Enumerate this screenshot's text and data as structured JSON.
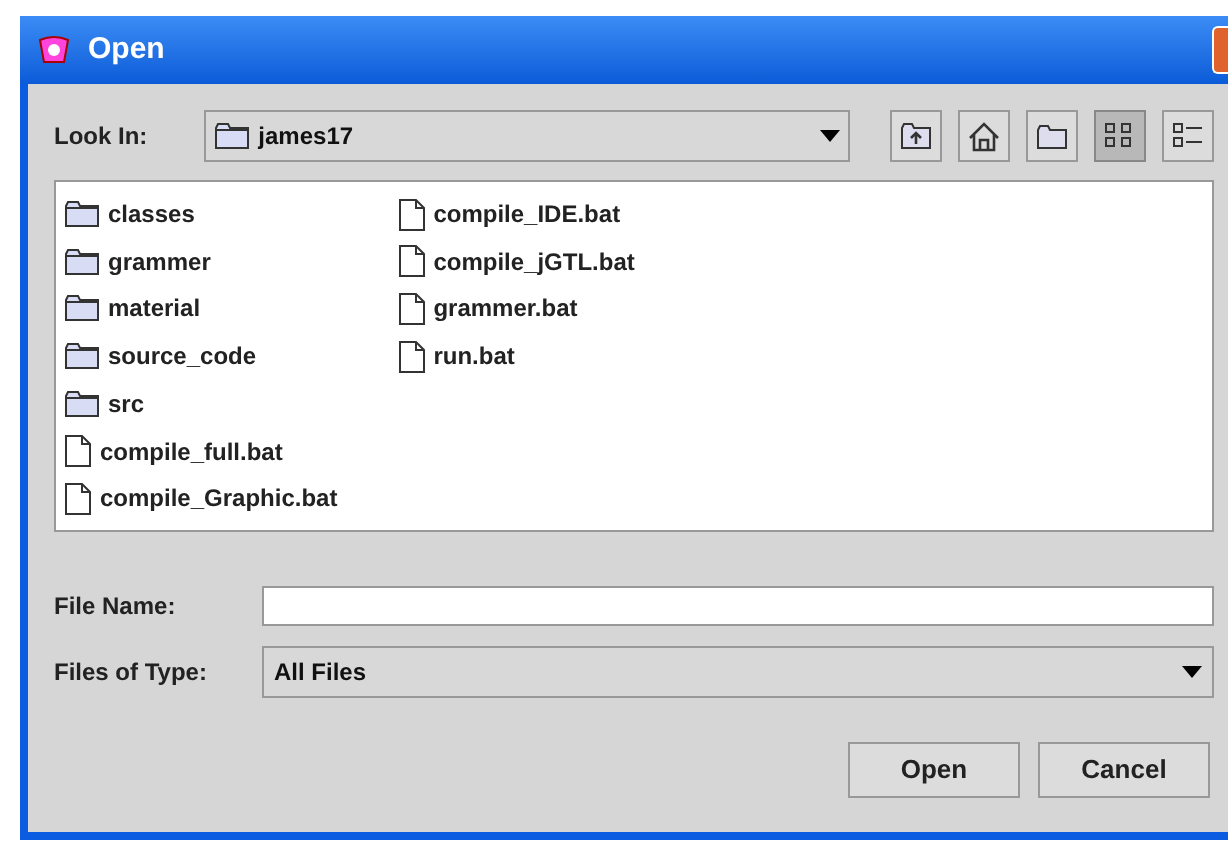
{
  "window": {
    "title": "Open"
  },
  "look_in": {
    "label": "Look In:",
    "value": "james17"
  },
  "toolbar": [
    {
      "kind": "up"
    },
    {
      "kind": "home"
    },
    {
      "kind": "new-folder"
    },
    {
      "kind": "list",
      "selected": true
    },
    {
      "kind": "details",
      "selected": false
    }
  ],
  "files": [
    {
      "name": "classes",
      "kind": "folder"
    },
    {
      "name": "grammer",
      "kind": "folder"
    },
    {
      "name": "material",
      "kind": "folder"
    },
    {
      "name": "source_code",
      "kind": "folder"
    },
    {
      "name": "src",
      "kind": "folder"
    },
    {
      "name": "compile_full.bat",
      "kind": "file"
    },
    {
      "name": "compile_Graphic.bat",
      "kind": "file"
    },
    {
      "name": "compile_IDE.bat",
      "kind": "file"
    },
    {
      "name": "compile_jGTL.bat",
      "kind": "file"
    },
    {
      "name": "grammer.bat",
      "kind": "file"
    },
    {
      "name": "run.bat",
      "kind": "file"
    }
  ],
  "file_name": {
    "label": "File Name:"
  },
  "files_of_type": {
    "label": "Files of Type:",
    "value": "All Files"
  },
  "buttons": [
    "Open",
    "Cancel"
  ]
}
